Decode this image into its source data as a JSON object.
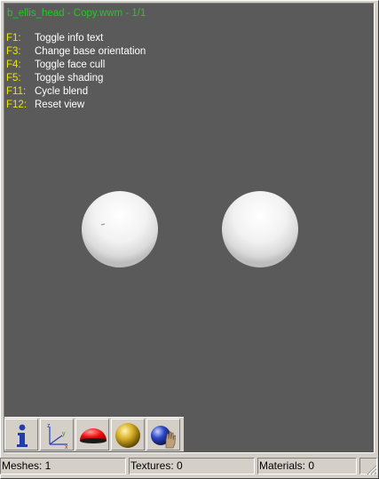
{
  "viewport": {
    "title": "b_ellis_head - Copy.wwm - 1/1",
    "help": [
      {
        "key": "F1:",
        "desc": "Toggle info text"
      },
      {
        "key": "F3:",
        "desc": "Change base orientation"
      },
      {
        "key": "F4:",
        "desc": "Toggle face cull"
      },
      {
        "key": "F5:",
        "desc": "Toggle shading"
      },
      {
        "key": "F11:",
        "desc": "Cycle blend"
      },
      {
        "key": "F12:",
        "desc": "Reset view"
      }
    ],
    "background": "#5a5a5a"
  },
  "toolbar": {
    "buttons": [
      {
        "icon": "info-icon"
      },
      {
        "icon": "axes-icon"
      },
      {
        "icon": "hemisphere-icon"
      },
      {
        "icon": "gold-sphere-icon"
      },
      {
        "icon": "sphere-hand-icon"
      }
    ]
  },
  "statusbar": {
    "meshes": "Meshes: 1",
    "textures": "Textures: 0",
    "materials": "Materials: 0"
  }
}
